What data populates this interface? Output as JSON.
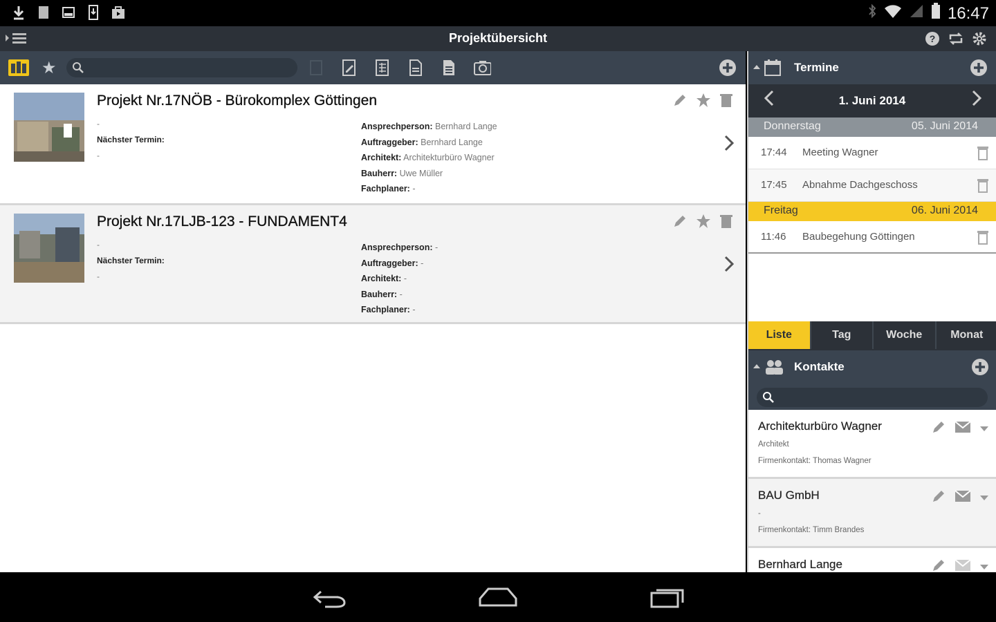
{
  "status_bar": {
    "time": "16:47"
  },
  "app_bar": {
    "title": "Projektübersicht"
  },
  "projects": [
    {
      "title": "Projekt Nr.17NÖB - Bürokomplex Göttingen",
      "dot1": "-",
      "next_label": "Nächster Termin:",
      "dot2": "-",
      "info": [
        {
          "label": "Ansprechperson:",
          "value": "Bernhard Lange"
        },
        {
          "label": "Auftraggeber:",
          "value": "Bernhard Lange"
        },
        {
          "label": "Architekt:",
          "value": "Architekturbüro Wagner"
        },
        {
          "label": "Bauherr:",
          "value": "Uwe Müller"
        },
        {
          "label": "Fachplaner:",
          "value": "-"
        }
      ]
    },
    {
      "title": "Projekt Nr.17LJB-123 - FUNDAMENT4",
      "dot1": "-",
      "next_label": "Nächster Termin:",
      "dot2": "-",
      "info": [
        {
          "label": "Ansprechperson:",
          "value": "-"
        },
        {
          "label": "Auftraggeber:",
          "value": "-"
        },
        {
          "label": "Architekt:",
          "value": "-"
        },
        {
          "label": "Bauherr:",
          "value": "-"
        },
        {
          "label": "Fachplaner:",
          "value": "-"
        }
      ]
    }
  ],
  "termine": {
    "header": "Termine",
    "current_date": "1. Juni 2014",
    "days": [
      {
        "name": "Donnerstag",
        "date": "05. Juni 2014",
        "appointments": [
          {
            "time": "17:44",
            "title": "Meeting Wagner"
          },
          {
            "time": "17:45",
            "title": "Abnahme Dachgeschoss"
          }
        ]
      },
      {
        "name": "Freitag",
        "date": "06. Juni 2014",
        "appointments": [
          {
            "time": "11:46",
            "title": "Baubegehung Göttingen"
          }
        ]
      }
    ],
    "tabs": [
      "Liste",
      "Tag",
      "Woche",
      "Monat"
    ]
  },
  "kontakte": {
    "header": "Kontakte",
    "items": [
      {
        "name": "Architekturbüro Wagner",
        "line1": "Architekt",
        "line2": "Firmenkontakt: Thomas Wagner"
      },
      {
        "name": "BAU GmbH",
        "line1": "-",
        "line2": "Firmenkontakt: Timm Brandes"
      },
      {
        "name": "Bernhard Lange",
        "line1": "",
        "line2": ""
      }
    ]
  },
  "colors": {
    "accent": "#f5c823",
    "bar": "#3a4450",
    "dark": "#2c3138"
  }
}
